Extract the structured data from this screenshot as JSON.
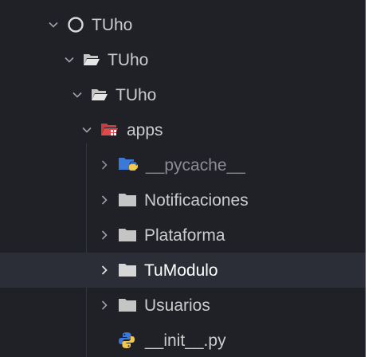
{
  "explorer": {
    "tree": [
      {
        "label": "TUho",
        "depth": 0,
        "state": "expanded",
        "icon": "circle-outline-icon"
      },
      {
        "label": "TUho",
        "depth": 1,
        "state": "expanded",
        "icon": "folder-open-icon"
      },
      {
        "label": "TUho",
        "depth": 2,
        "state": "expanded",
        "icon": "folder-open-icon"
      },
      {
        "label": "apps",
        "depth": 3,
        "state": "expanded",
        "icon": "folder-apps-icon"
      },
      {
        "label": "__pycache__",
        "depth": 4,
        "state": "collapsed",
        "icon": "folder-python-icon"
      },
      {
        "label": "Notificaciones",
        "depth": 4,
        "state": "collapsed",
        "icon": "folder-icon"
      },
      {
        "label": "Plataforma",
        "depth": 4,
        "state": "collapsed",
        "icon": "folder-icon"
      },
      {
        "label": "TuModulo",
        "depth": 4,
        "state": "collapsed",
        "icon": "folder-icon",
        "selected": true
      },
      {
        "label": "Usuarios",
        "depth": 4,
        "state": "collapsed",
        "icon": "folder-icon"
      },
      {
        "label": "__init__.py",
        "depth": 4,
        "state": "file",
        "icon": "python-file-icon"
      }
    ],
    "colors": {
      "background": "#1f2127",
      "selected_row": "#2b2e37",
      "text": "#cccccc",
      "text_dim": "#8a8d93",
      "folder": "#c5c5c5",
      "apps_folder": "#e04a4a",
      "python_blue": "#3c78d8",
      "python_yellow": "#f2c94c"
    }
  }
}
